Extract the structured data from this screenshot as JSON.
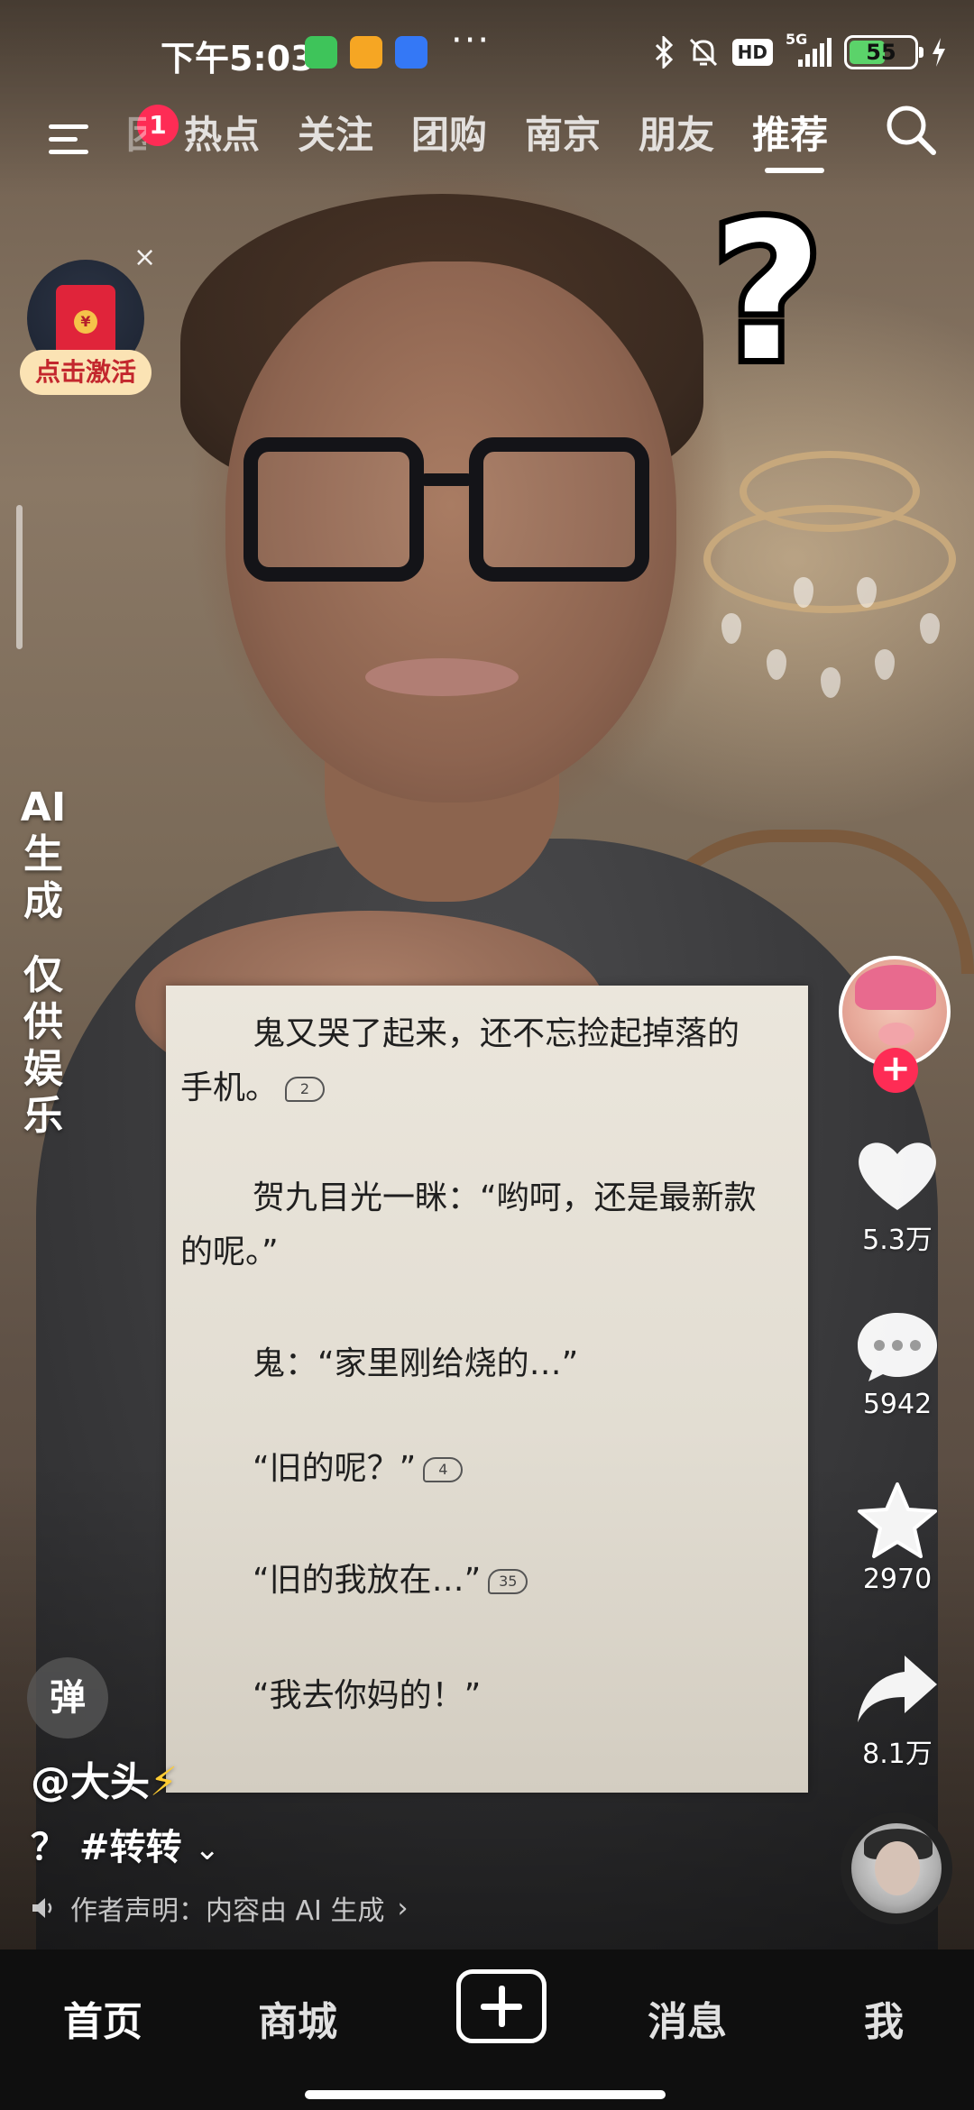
{
  "status_bar": {
    "time": "下午5:03",
    "network": "5G",
    "hd_label": "HD",
    "battery": "55"
  },
  "top_nav": {
    "notification_count": "1",
    "tabs": [
      "团",
      "热点",
      "关注",
      "团购",
      "南京",
      "朋友",
      "推荐"
    ],
    "active_tab": "推荐"
  },
  "red_packet": {
    "label": "点击激活",
    "close": "×"
  },
  "ai_label": {
    "line1": [
      "AI",
      "生",
      "成"
    ],
    "line2": [
      "仅",
      "供",
      "娱",
      "乐"
    ]
  },
  "overlay_mark": "?",
  "text_card": {
    "lines": [
      {
        "text": "鬼又哭了起来，还不忘捡起掉落的",
        "comments": ""
      },
      {
        "text": "手机。",
        "comments": "2"
      },
      {
        "text": "贺九目光一眯：“哟呵，还是最新款",
        "comments": ""
      },
      {
        "text": "的呢。”",
        "comments": ""
      },
      {
        "text": "鬼：“家里刚给烧的…”",
        "comments": ""
      },
      {
        "text": "“旧的呢？”",
        "comments": "4"
      },
      {
        "text": "“旧的我放在…”",
        "comments": "35"
      },
      {
        "text": "“我去你妈的！”",
        "comments": ""
      }
    ]
  },
  "actions": {
    "likes": "5.3万",
    "comments": "5942",
    "favorites": "2970",
    "shares": "8.1万",
    "follow": "+"
  },
  "danmu_label": "弹",
  "author": {
    "name": "@大头",
    "bolt": "⚡"
  },
  "description": {
    "text": "？ #转转"
  },
  "declaration": "作者声明：内容由 AI 生成",
  "bottom_nav": {
    "home": "首页",
    "mall": "商城",
    "messages": "消息",
    "me": "我"
  },
  "colors": {
    "accent": "#fe2c55",
    "nav_bg": "#0f0f0f",
    "card_bg": "#e6e1d7"
  },
  "icons": [
    "menu-icon",
    "search-icon",
    "heart-icon",
    "comment-icon",
    "star-icon",
    "share-icon",
    "bluetooth-icon",
    "mute-icon",
    "signal-icon",
    "battery-icon",
    "plus-icon",
    "speaker-icon"
  ]
}
